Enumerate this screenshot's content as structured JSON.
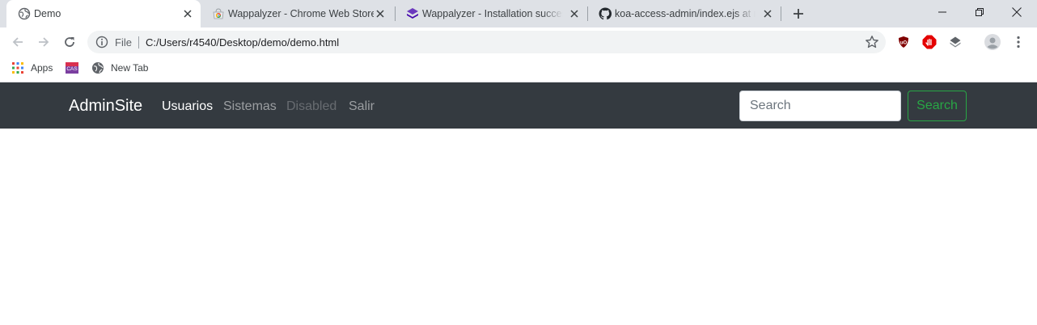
{
  "tabs": [
    {
      "title": "Demo",
      "favicon": "globe-icon",
      "active": true
    },
    {
      "title": "Wappalyzer - Chrome Web Store",
      "favicon": "chrome-web-store-icon",
      "active": false
    },
    {
      "title": "Wappalyzer - Installation success",
      "favicon": "wappalyzer-icon",
      "active": false
    },
    {
      "title": "koa-access-admin/index.ejs at m",
      "favicon": "github-icon",
      "active": false
    }
  ],
  "address": {
    "scheme_label": "File",
    "url": "C:/Users/r4540/Desktop/demo/demo.html"
  },
  "bookmarks": [
    {
      "label": "Apps",
      "icon": "apps-grid-icon"
    },
    {
      "label": "",
      "icon": "cas-icon",
      "icon_text": "CAS"
    },
    {
      "label": "New Tab",
      "icon": "globe-icon"
    }
  ],
  "extensions": [
    "ublock-origin-icon",
    "adblock-icon",
    "wappalyzer-extension-icon"
  ],
  "navbar": {
    "brand": "AdminSite",
    "links": [
      {
        "label": "Usuarios",
        "state": "active"
      },
      {
        "label": "Sistemas",
        "state": "normal"
      },
      {
        "label": "Disabled",
        "state": "disabled"
      },
      {
        "label": "Salir",
        "state": "normal"
      }
    ],
    "search_placeholder": "Search",
    "search_button": "Search"
  },
  "colors": {
    "navbar_bg": "#343a40",
    "success_green": "#28a745",
    "tabstrip_bg": "#dee1e6"
  }
}
